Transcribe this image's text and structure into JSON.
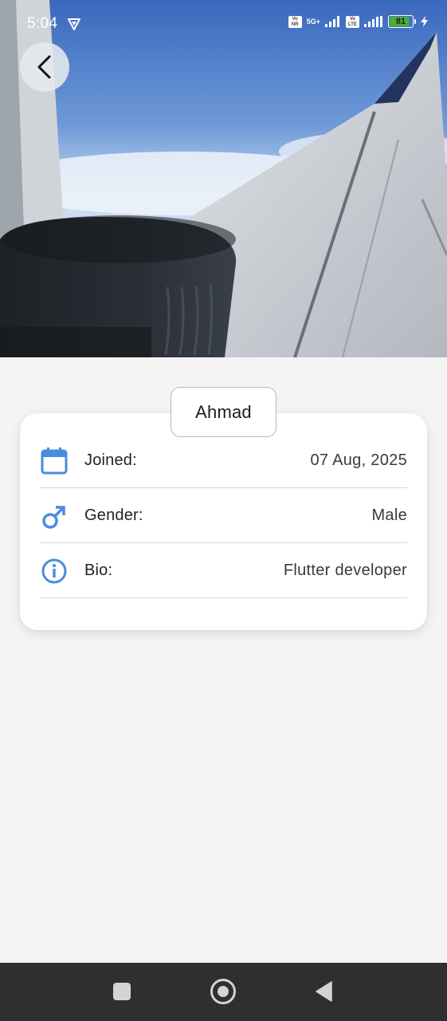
{
  "status_bar": {
    "time": "5:04",
    "sim1_label": "Vo NR",
    "net1_label": "5G+",
    "sim2_label": "Vo LTE",
    "battery_level": "81"
  },
  "header": {
    "back_icon": "chevron-left-icon"
  },
  "profile": {
    "name": "Ahmad",
    "rows": [
      {
        "icon": "calendar-icon",
        "label": "Joined:",
        "value": "07 Aug, 2025"
      },
      {
        "icon": "male-icon",
        "label": "Gender:",
        "value": "Male"
      },
      {
        "icon": "info-icon",
        "label": "Bio:",
        "value": "Flutter developer"
      }
    ]
  },
  "colors": {
    "accent": "#4a8cde",
    "background": "#f4f4f5",
    "card": "#ffffff",
    "nav_bar": "#2f2f2f"
  },
  "nav_bar": {
    "recents_icon": "square-icon",
    "home_icon": "circle-home-icon",
    "back_icon": "triangle-back-icon"
  }
}
